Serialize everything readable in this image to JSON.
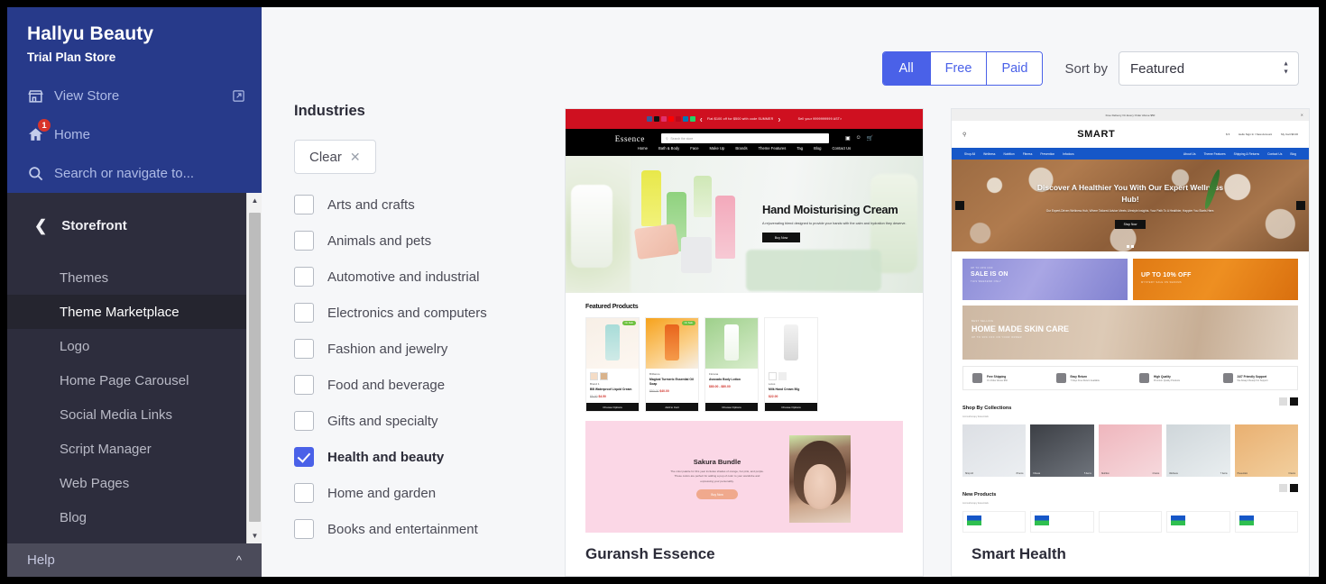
{
  "sidebar": {
    "store_name": "Hallyu Beauty",
    "store_plan": "Trial Plan Store",
    "view_store": "View Store",
    "home": "Home",
    "home_badge": "1",
    "search_placeholder": "Search or navigate to...",
    "section_title": "Storefront",
    "nav_items": [
      {
        "label": "Themes",
        "active": false
      },
      {
        "label": "Theme Marketplace",
        "active": true
      },
      {
        "label": "Logo",
        "active": false
      },
      {
        "label": "Home Page Carousel",
        "active": false
      },
      {
        "label": "Social Media Links",
        "active": false
      },
      {
        "label": "Script Manager",
        "active": false
      },
      {
        "label": "Web Pages",
        "active": false
      },
      {
        "label": "Blog",
        "active": false
      }
    ],
    "help": "Help"
  },
  "toolbar": {
    "tabs": [
      {
        "label": "All",
        "active": true
      },
      {
        "label": "Free",
        "active": false
      },
      {
        "label": "Paid",
        "active": false
      }
    ],
    "sort_label": "Sort by",
    "sort_value": "Featured"
  },
  "filters": {
    "title": "Industries",
    "clear_label": "Clear",
    "items": [
      {
        "label": "Arts and crafts",
        "checked": false
      },
      {
        "label": "Animals and pets",
        "checked": false
      },
      {
        "label": "Automotive and industrial",
        "checked": false
      },
      {
        "label": "Electronics and computers",
        "checked": false
      },
      {
        "label": "Fashion and jewelry",
        "checked": false
      },
      {
        "label": "Food and beverage",
        "checked": false
      },
      {
        "label": "Gifts and specialty",
        "checked": false
      },
      {
        "label": "Health and beauty",
        "checked": true
      },
      {
        "label": "Home and garden",
        "checked": false
      },
      {
        "label": "Books and entertainment",
        "checked": false
      }
    ]
  },
  "themes": [
    {
      "name": "Guransh Essence",
      "preview": {
        "promo": "Flat $100 off for $500 with code SUMMER",
        "promo_right": "Sell your 9999999999  AST>",
        "logo": "Essence",
        "search_placeholder": "Search the store",
        "nav": [
          "Home",
          "Bath & Body",
          "Face",
          "Make Up",
          "Brands",
          "Theme Features",
          "Tag",
          "Blog",
          "Contact Us"
        ],
        "hero_heading": "Hand Moisturising Cream",
        "hero_text": "A rejuvenating blend designed to provide your hands with the calm and hydration they deserve.",
        "hero_button": "Buy Now",
        "featured_title": "Featured Products",
        "products": [
          {
            "brand": "Brand 1",
            "name": "BB Waterproof Liquid Cream",
            "old": "$5.00",
            "new": "$4.50",
            "badge": "On Sale",
            "button": "Choose Options"
          },
          {
            "brand": "Brillance",
            "name": "Magical Turmeric Essential Oil Soap",
            "old": "$50.00",
            "new": "$40.00",
            "badge": "On Sale",
            "button": "Add to Cart"
          },
          {
            "brand": "Florana",
            "name": "Avocado Body Lotion",
            "old": "",
            "new": "$80.00 - $80.00",
            "badge": "",
            "button": "Choose Options"
          },
          {
            "brand": "Lotus",
            "name": "Milk Hand Cream 50g",
            "old": "",
            "new": "$22.00",
            "badge": "",
            "button": "Choose Options"
          }
        ],
        "banner_heading": "Sakura Bundle",
        "banner_text": "The color palette for this year includes shades of orange, hot pink, and purple. These colors are perfect for adding a pop of color to your wardrobe and expressing your personality.",
        "banner_button": "Buy Now"
      }
    },
    {
      "name": "Smart Health",
      "preview": {
        "announcement": "Free Delivery On Every Order Above $50",
        "logo": "SMART",
        "header_account": "Hello Sign In / New Account",
        "header_cart": "My Cart $0.00",
        "nav_left": [
          "Shop All",
          "Wellness",
          "Nutrition",
          "Fitness",
          "Prevention",
          "Infodocs"
        ],
        "nav_right": [
          "About Us",
          "Theme Features",
          "Shipping & Returns",
          "Contact Us",
          "Blog"
        ],
        "hero_heading": "Discover A Healthier You With Our Expert Wellness Hub!",
        "hero_text": "Our Expert-Driven Wellness Hub, Where Tailored Advice Meets Lifestyle Insights. Your Path To A Healthier, Happier You Starts Here.",
        "hero_button": "Shop Now",
        "banners": [
          {
            "kicker": "UP TO 20% OFF",
            "title": "SALE IS ON",
            "sub": "THIS WEEKEND ONLY"
          },
          {
            "kicker": "",
            "title": "UP TO 10% OFF",
            "sub": "MYSTERY SALE ON SERUMS"
          }
        ],
        "wide_banner": {
          "kicker": "BEST SELLING",
          "title": "HOME MADE SKIN CARE",
          "sub": "UP TO 30% OFF ON YOUR ORDER"
        },
        "features": [
          {
            "title": "Free Shipping",
            "sub": "On Order Above $50"
          },
          {
            "title": "Easy Return",
            "sub": "7 Days Free Return Available"
          },
          {
            "title": "High Quality",
            "sub": "Premium Quality Products"
          },
          {
            "title": "24/7 Friendly Support",
            "sub": "We Always Ready For Support"
          }
        ],
        "collections_title": "Shop By Collections",
        "collections_sub": "Aromatherapy Essentials",
        "new_products_title": "New Products",
        "new_products_sub": "Aromatherapy Essentials"
      }
    }
  ]
}
